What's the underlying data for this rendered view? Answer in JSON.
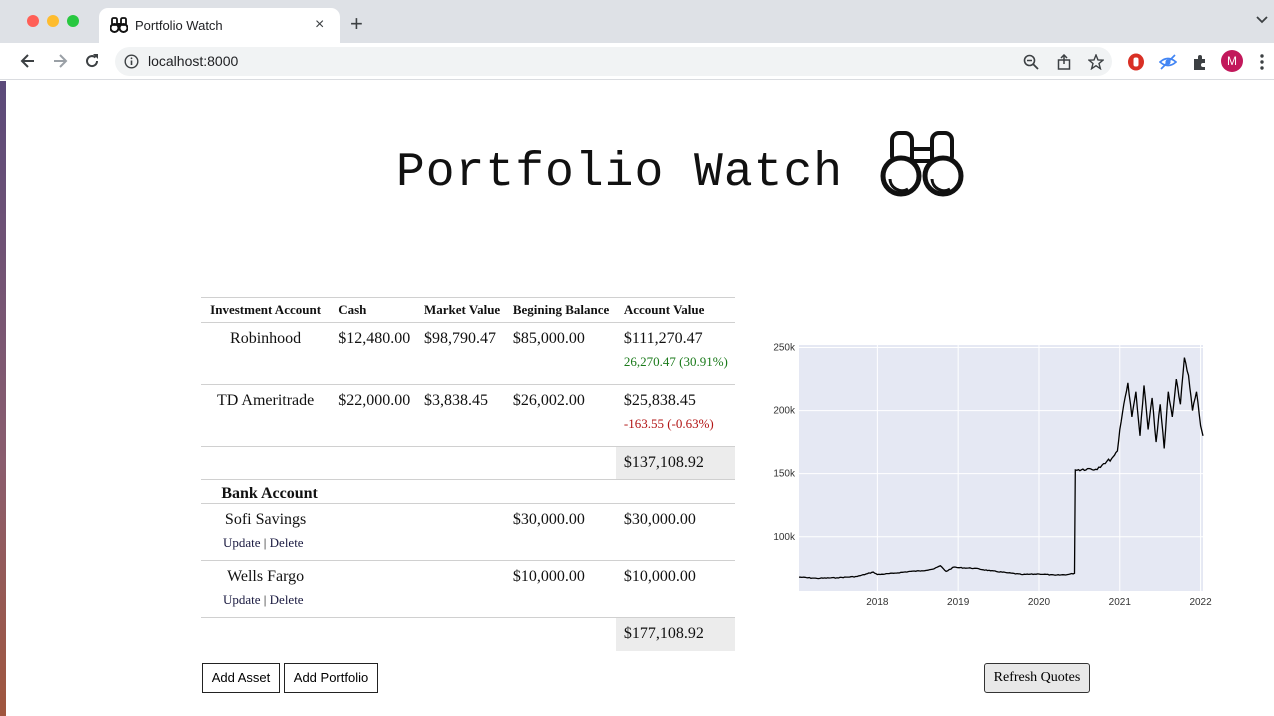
{
  "browser": {
    "tab_title": "Portfolio Watch",
    "url": "localhost:8000",
    "profile_initial": "M",
    "tab_close": "×",
    "new_tab": "+"
  },
  "header": {
    "title": "Portfolio Watch",
    "icon": "binoculars-icon"
  },
  "table": {
    "columns": [
      "Investment Account",
      "Cash",
      "Market Value",
      "Begining Balance",
      "Account Value"
    ],
    "investment_accounts": [
      {
        "name": "Robinhood",
        "cash": "$12,480.00",
        "market_value": "$98,790.47",
        "beginning_balance": "$85,000.00",
        "account_value": "$111,270.47",
        "change": "26,270.47 (30.91%)",
        "direction": "up"
      },
      {
        "name": "TD Ameritrade",
        "cash": "$22,000.00",
        "market_value": "$3,838.45",
        "beginning_balance": "$26,002.00",
        "account_value": "$25,838.45",
        "change": "-163.55 (-0.63%)",
        "direction": "down"
      }
    ],
    "investment_total": "$137,108.92",
    "bank_header": "Bank Account",
    "bank_accounts": [
      {
        "name": "Sofi Savings",
        "beginning_balance": "$30,000.00",
        "account_value": "$30,000.00",
        "update_label": "Update",
        "delete_label": "Delete",
        "separator": "|"
      },
      {
        "name": "Wells Fargo",
        "beginning_balance": "$10,000.00",
        "account_value": "$10,000.00",
        "update_label": "Update",
        "delete_label": "Delete",
        "separator": "|"
      }
    ],
    "grand_total": "$177,108.92"
  },
  "buttons": {
    "add_asset": "Add Asset",
    "add_portfolio": "Add Portfolio",
    "refresh_quotes": "Refresh Quotes"
  },
  "chart_data": {
    "type": "line",
    "title": "",
    "xlabel": "",
    "ylabel": "",
    "x_ticks": [
      "2018",
      "2019",
      "2020",
      "2021",
      "2022"
    ],
    "y_ticks": [
      "100k",
      "150k",
      "200k",
      "250k"
    ],
    "xlim": [
      2017.03,
      2022.03
    ],
    "ylim": [
      57000,
      252000
    ],
    "grid": true,
    "plot_bg": "#e5e8f3",
    "line_color": "#000000",
    "series": [
      {
        "x": [
          2017.03,
          2017.25,
          2017.5,
          2017.75,
          2017.95,
          2018.0,
          2018.2,
          2018.4,
          2018.55,
          2018.7,
          2018.78,
          2018.85,
          2018.95,
          2019.0,
          2019.2,
          2019.4,
          2019.6,
          2019.8,
          2020.0,
          2020.2,
          2020.35,
          2020.44,
          2020.45,
          2020.6,
          2020.7,
          2020.8,
          2020.9,
          2020.97,
          2021.0,
          2021.05,
          2021.1,
          2021.15,
          2021.2,
          2021.25,
          2021.3,
          2021.35,
          2021.4,
          2021.45,
          2021.5,
          2021.55,
          2021.6,
          2021.65,
          2021.7,
          2021.75,
          2021.8,
          2021.85,
          2021.9,
          2021.95,
          2022.0,
          2022.03
        ],
        "y": [
          68000,
          67000,
          67500,
          68500,
          72000,
          70000,
          71000,
          72500,
          73000,
          74500,
          77000,
          72500,
          76000,
          75500,
          75000,
          73000,
          71500,
          70000,
          70500,
          69500,
          70000,
          71000,
          153000,
          154000,
          153500,
          158000,
          162000,
          168000,
          185000,
          205000,
          222000,
          195000,
          215000,
          180000,
          220000,
          185000,
          210000,
          175000,
          205000,
          170000,
          215000,
          195000,
          225000,
          205000,
          242000,
          228000,
          200000,
          215000,
          188000,
          180000
        ]
      }
    ]
  }
}
